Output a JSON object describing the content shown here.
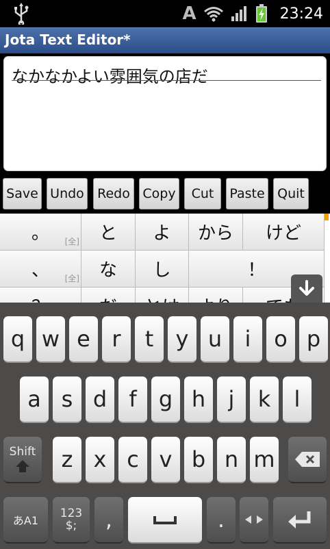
{
  "status_bar": {
    "time": "23:24",
    "ime_indicator": "A",
    "icons": [
      "usb-icon",
      "wifi-icon",
      "signal-icon",
      "battery-charging-icon"
    ]
  },
  "app": {
    "title": "Jota Text Editor*"
  },
  "editor": {
    "text": "なかなかよい雰囲気の店だ"
  },
  "toolbar": {
    "buttons": [
      {
        "label": "Save"
      },
      {
        "label": "Undo"
      },
      {
        "label": "Redo"
      },
      {
        "label": "Copy"
      },
      {
        "label": "Cut"
      },
      {
        "label": "Paste"
      },
      {
        "label": "Quit"
      }
    ]
  },
  "candidates": {
    "rows": [
      [
        "。",
        "と",
        "よ",
        "から",
        "けど"
      ],
      [
        "、",
        "な",
        "し",
        "！"
      ],
      [
        "？",
        "だ",
        "とは",
        "より",
        "でも"
      ]
    ],
    "fullwidth_tag": "[全]"
  },
  "keyboard": {
    "row1": [
      "q",
      "w",
      "e",
      "r",
      "t",
      "y",
      "u",
      "i",
      "o",
      "p"
    ],
    "row2": [
      "a",
      "s",
      "d",
      "f",
      "g",
      "h",
      "j",
      "k",
      "l"
    ],
    "row3": [
      "z",
      "x",
      "c",
      "v",
      "b",
      "n",
      "m"
    ],
    "shift_label": "Shift",
    "mode_label": "あA1",
    "symbols_label_1": "123",
    "symbols_label_2": "$;",
    "comma": ",",
    "period": "."
  },
  "colors": {
    "title_bar": "#2c4f8c",
    "keyboard_bg": "#4d4b49",
    "underline": "#cc2233"
  }
}
